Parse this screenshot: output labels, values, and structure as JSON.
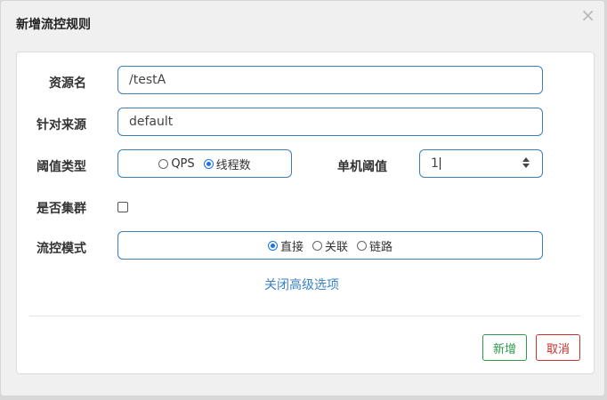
{
  "dialog": {
    "title": "新增流控规则",
    "close_glyph": "×"
  },
  "form": {
    "resource_label": "资源名",
    "resource_value": "/testA",
    "source_label": "针对来源",
    "source_value": "default",
    "threshold_type_label": "阈值类型",
    "threshold_type_options": [
      {
        "label": "QPS",
        "selected": false
      },
      {
        "label": "线程数",
        "selected": true
      }
    ],
    "single_threshold_label": "单机阈值",
    "single_threshold_value": "1",
    "cluster_label": "是否集群",
    "cluster_checked": false,
    "flow_mode_label": "流控模式",
    "flow_mode_options": [
      {
        "label": "直接",
        "selected": true
      },
      {
        "label": "关联",
        "selected": false
      },
      {
        "label": "链路",
        "selected": false
      }
    ],
    "advanced_toggle": "关闭高级选项"
  },
  "footer": {
    "add_label": "新增",
    "cancel_label": "取消"
  },
  "colors": {
    "input_border": "#3d7fb8",
    "link": "#3b82c4",
    "add": "#2f9a4a",
    "cancel": "#c9302c",
    "radio_selected": "#1a73e8"
  },
  "icons": [
    "close-icon",
    "spinner-up-icon",
    "spinner-down-icon"
  ]
}
